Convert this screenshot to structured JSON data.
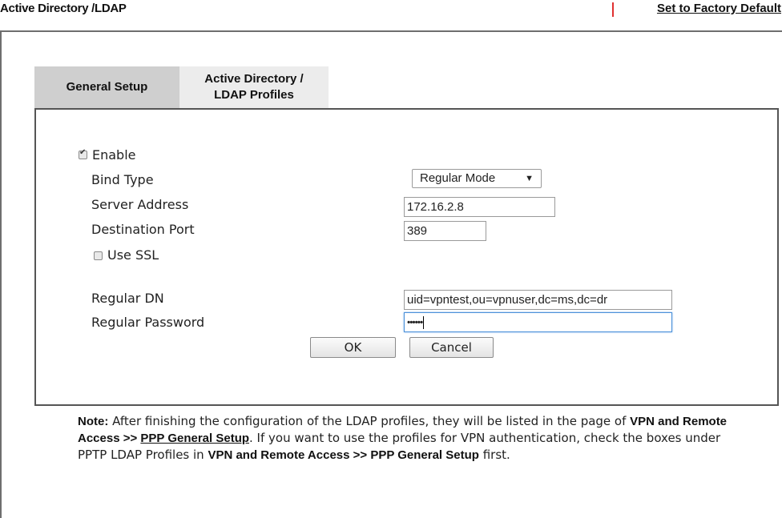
{
  "header": {
    "title": "Active Directory /LDAP",
    "factory_default_link": "Set to Factory Default"
  },
  "tabs": [
    {
      "label": "General Setup",
      "active": true
    },
    {
      "label_line1": "Active Directory /",
      "label_line2": "LDAP Profiles",
      "active": false
    }
  ],
  "form": {
    "enable": {
      "label": "Enable",
      "checked": true
    },
    "bind_type": {
      "label": "Bind Type",
      "value": "Regular Mode"
    },
    "server_address": {
      "label": "Server Address",
      "value": "172.16.2.8"
    },
    "destination_port": {
      "label": "Destination Port",
      "value": "389"
    },
    "use_ssl": {
      "label": "Use SSL",
      "checked": false
    },
    "regular_dn": {
      "label": "Regular DN",
      "value": "uid=vpntest,ou=vpnuser,dc=ms,dc=dr"
    },
    "regular_password": {
      "label": "Regular Password",
      "value": "••••••"
    },
    "ok_label": "OK",
    "cancel_label": "Cancel"
  },
  "note": {
    "prefix": "Note:",
    "t1": " After finishing the configuration of the LDAP profiles, they will be listed in the page of ",
    "b1": "VPN and Remote Access >> ",
    "link": "PPP General Setup",
    "t2": ". If you want to use the profiles for VPN authentication, check the boxes under PPTP LDAP Profiles in ",
    "b2": "VPN and Remote Access >> PPP General Setup",
    "t3": " first."
  },
  "colors": {
    "divider_red": "#e03030",
    "tab_active": "#cfcfcf",
    "tab_inactive": "#ececec",
    "focus_border": "#4a90d9"
  },
  "icons": {
    "checkbox_checked": "check-mark",
    "dropdown": "triangle-down"
  }
}
